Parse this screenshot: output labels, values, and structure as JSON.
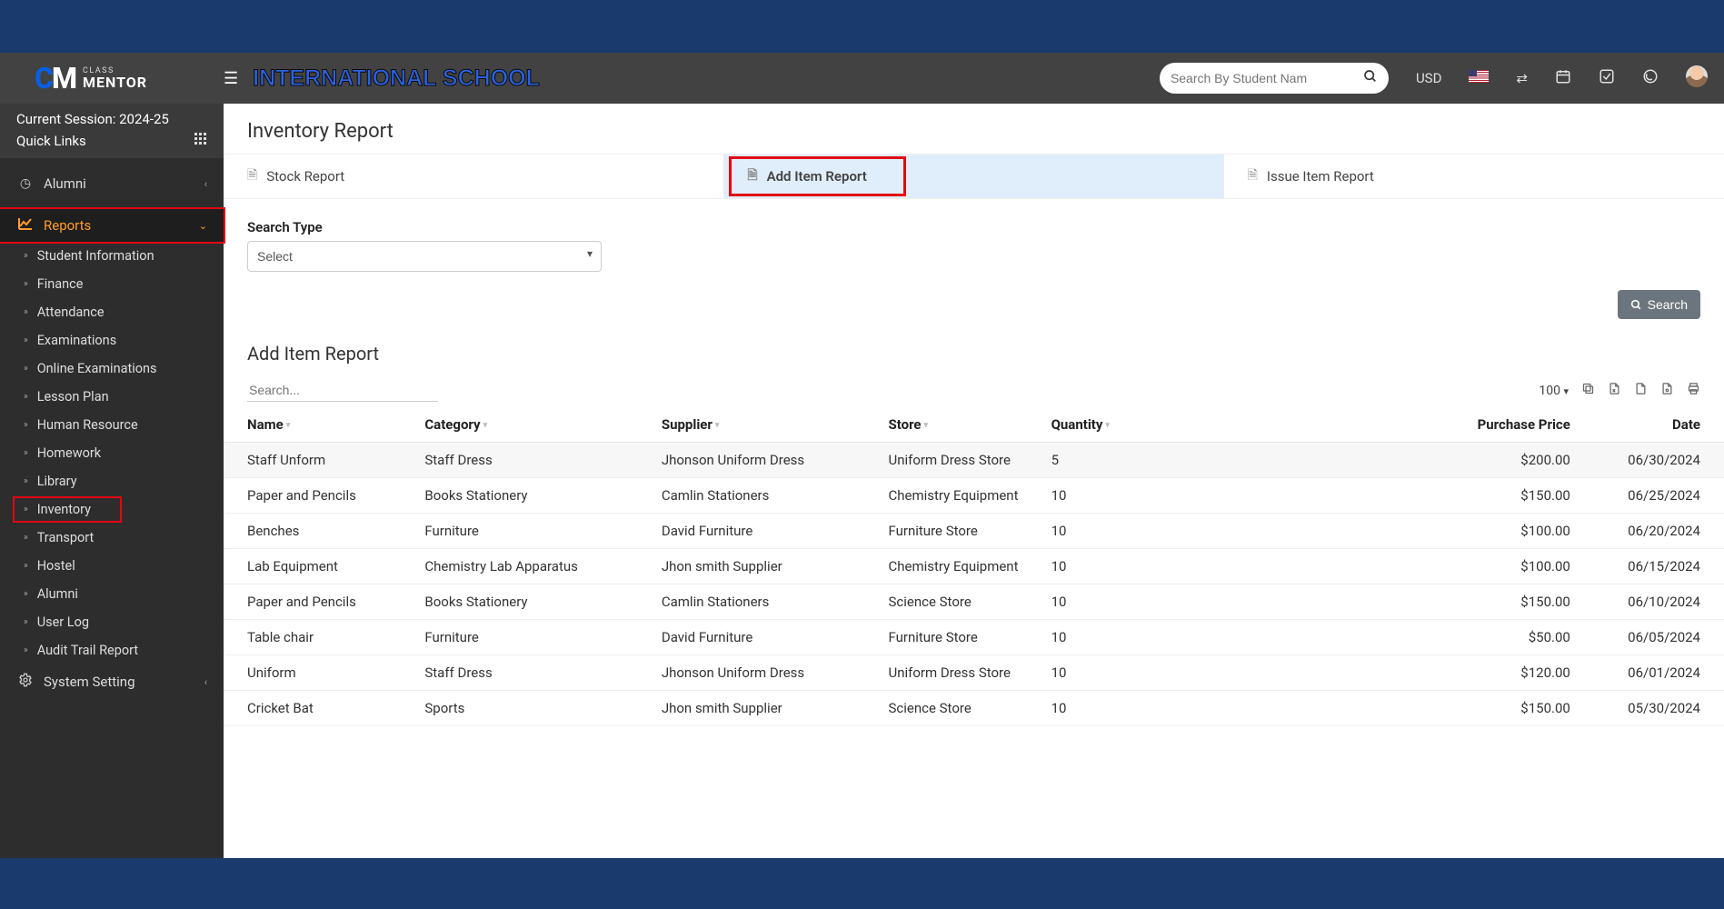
{
  "header": {
    "logo_small": "CLASS",
    "logo_big": "MENTOR",
    "school_name": "INTERNATIONAL SCHOOL",
    "search_placeholder": "Search By Student Nam",
    "currency": "USD"
  },
  "sidebar": {
    "session": "Current Session: 2024-25",
    "quick_links": "Quick Links",
    "items": [
      "Alumni",
      "Reports",
      "System Setting"
    ],
    "reports_sub": [
      "Student Information",
      "Finance",
      "Attendance",
      "Examinations",
      "Online Examinations",
      "Lesson Plan",
      "Human Resource",
      "Homework",
      "Library",
      "Inventory",
      "Transport",
      "Hostel",
      "Alumni",
      "User Log",
      "Audit Trail Report"
    ]
  },
  "main": {
    "title": "Inventory Report",
    "tabs": [
      "Stock Report",
      "Add Item Report",
      "Issue Item Report"
    ],
    "search_type_label": "Search Type",
    "search_type_value": "Select",
    "search_button": "Search",
    "section_title": "Add Item Report",
    "table_search_placeholder": "Search...",
    "page_size": "100",
    "columns": [
      "Name",
      "Category",
      "Supplier",
      "Store",
      "Quantity",
      "Purchase Price",
      "Date"
    ],
    "rows": [
      {
        "name": "Staff Unform",
        "category": "Staff Dress",
        "supplier": "Jhonson Uniform Dress",
        "store": "Uniform Dress Store",
        "qty": "5",
        "price": "$200.00",
        "date": "06/30/2024"
      },
      {
        "name": "Paper and Pencils",
        "category": "Books Stationery",
        "supplier": "Camlin Stationers",
        "store": "Chemistry Equipment",
        "qty": "10",
        "price": "$150.00",
        "date": "06/25/2024"
      },
      {
        "name": "Benches",
        "category": "Furniture",
        "supplier": "David Furniture",
        "store": "Furniture Store",
        "qty": "10",
        "price": "$100.00",
        "date": "06/20/2024"
      },
      {
        "name": "Lab Equipment",
        "category": "Chemistry Lab Apparatus",
        "supplier": "Jhon smith Supplier",
        "store": "Chemistry Equipment",
        "qty": "10",
        "price": "$100.00",
        "date": "06/15/2024"
      },
      {
        "name": "Paper and Pencils",
        "category": "Books Stationery",
        "supplier": "Camlin Stationers",
        "store": "Science Store",
        "qty": "10",
        "price": "$150.00",
        "date": "06/10/2024"
      },
      {
        "name": "Table chair",
        "category": "Furniture",
        "supplier": "David Furniture",
        "store": "Furniture Store",
        "qty": "10",
        "price": "$50.00",
        "date": "06/05/2024"
      },
      {
        "name": "Uniform",
        "category": "Staff Dress",
        "supplier": "Jhonson Uniform Dress",
        "store": "Uniform Dress Store",
        "qty": "10",
        "price": "$120.00",
        "date": "06/01/2024"
      },
      {
        "name": "Cricket Bat",
        "category": "Sports",
        "supplier": "Jhon smith Supplier",
        "store": "Science Store",
        "qty": "10",
        "price": "$150.00",
        "date": "05/30/2024"
      }
    ]
  }
}
